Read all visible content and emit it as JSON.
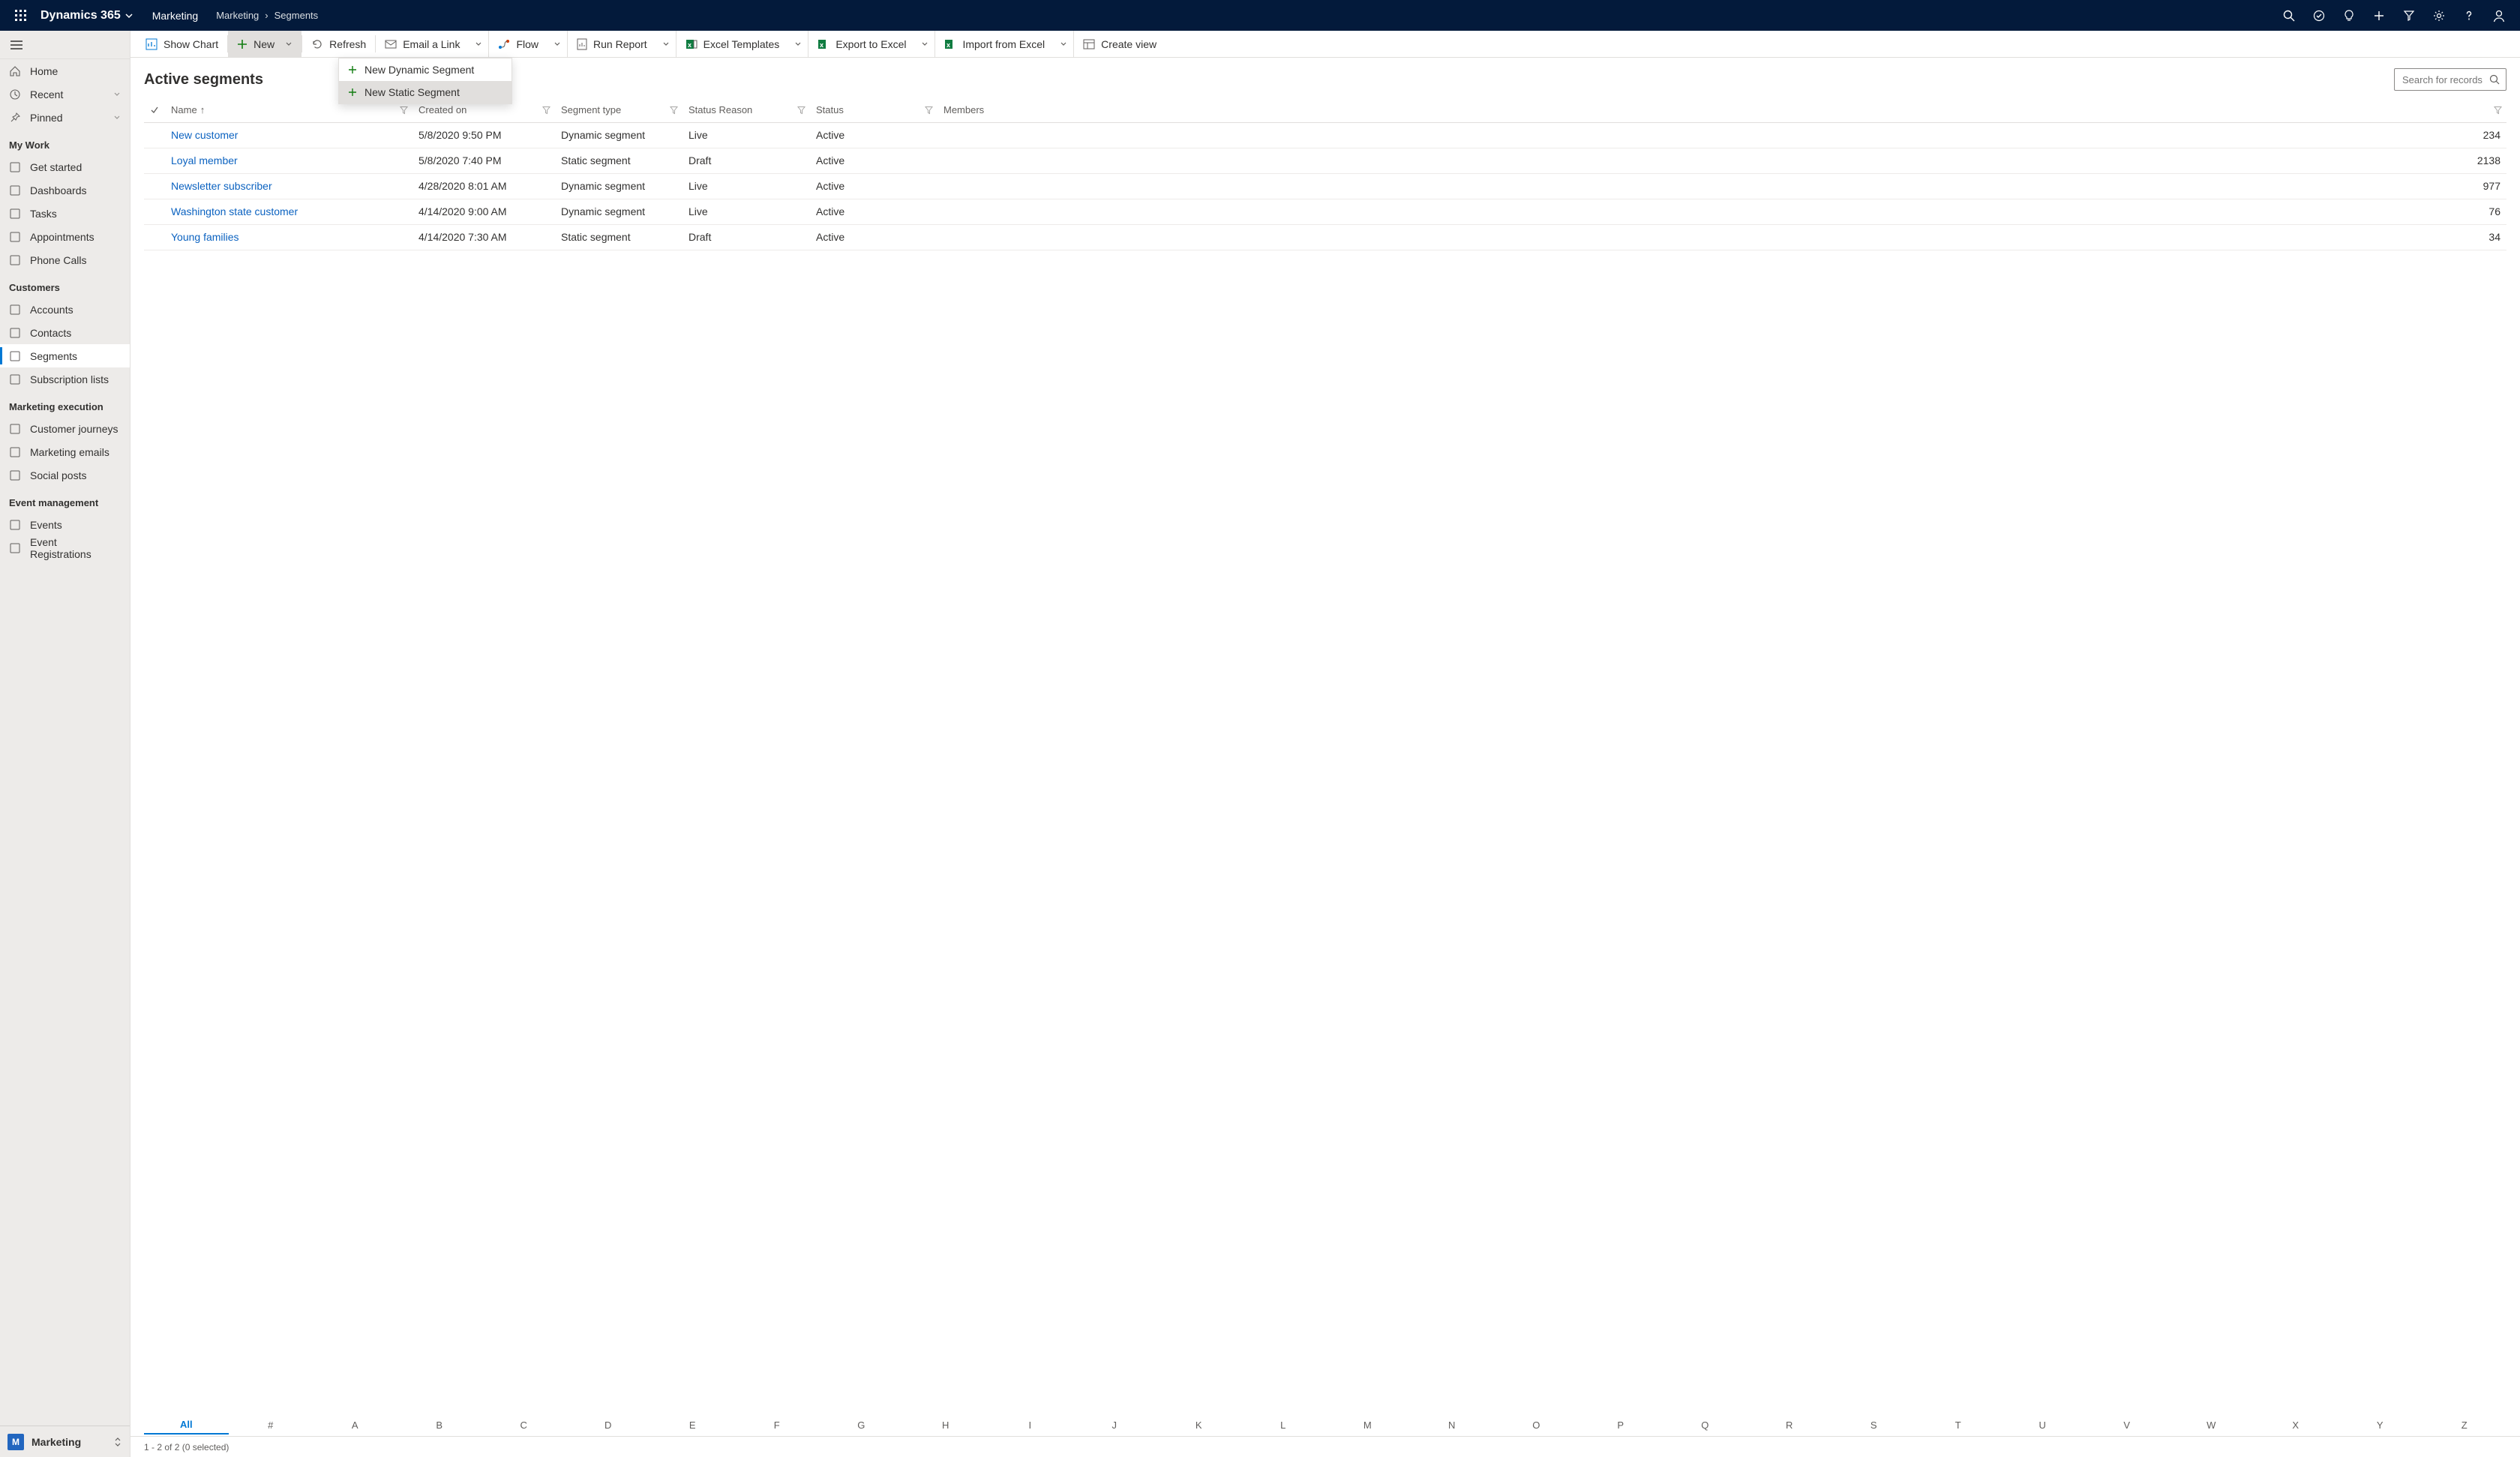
{
  "topnav": {
    "brand": "Dynamics 365",
    "area": "Marketing",
    "breadcrumb": [
      "Marketing",
      "Segments"
    ]
  },
  "sidebar": {
    "top": [
      {
        "label": "Home"
      },
      {
        "label": "Recent",
        "chevron": true
      },
      {
        "label": "Pinned",
        "chevron": true
      }
    ],
    "groups": [
      {
        "title": "My Work",
        "items": [
          {
            "label": "Get started"
          },
          {
            "label": "Dashboards"
          },
          {
            "label": "Tasks"
          },
          {
            "label": "Appointments"
          },
          {
            "label": "Phone Calls"
          }
        ]
      },
      {
        "title": "Customers",
        "items": [
          {
            "label": "Accounts"
          },
          {
            "label": "Contacts"
          },
          {
            "label": "Segments",
            "active": true
          },
          {
            "label": "Subscription lists"
          }
        ]
      },
      {
        "title": "Marketing execution",
        "items": [
          {
            "label": "Customer journeys"
          },
          {
            "label": "Marketing emails"
          },
          {
            "label": "Social posts"
          }
        ]
      },
      {
        "title": "Event management",
        "items": [
          {
            "label": "Events"
          },
          {
            "label": "Event Registrations"
          }
        ]
      }
    ],
    "area_switch": {
      "initial": "M",
      "label": "Marketing"
    }
  },
  "commands": {
    "show_chart": "Show Chart",
    "new": "New",
    "refresh": "Refresh",
    "email_link": "Email a Link",
    "flow": "Flow",
    "run_report": "Run Report",
    "excel_templates": "Excel Templates",
    "export_excel": "Export to Excel",
    "import_excel": "Import from Excel",
    "create_view": "Create view"
  },
  "new_menu": {
    "dynamic": "New Dynamic Segment",
    "static": "New Static Segment"
  },
  "view": {
    "title": "Active segments",
    "search_placeholder": "Search for records"
  },
  "columns": {
    "name": "Name",
    "created": "Created on",
    "type": "Segment type",
    "reason": "Status Reason",
    "status": "Status",
    "members": "Members"
  },
  "rows": [
    {
      "name": "New customer",
      "created": "5/8/2020 9:50 PM",
      "type": "Dynamic segment",
      "reason": "Live",
      "status": "Active",
      "members": "234"
    },
    {
      "name": "Loyal member",
      "created": "5/8/2020 7:40 PM",
      "type": "Static segment",
      "reason": "Draft",
      "status": "Active",
      "members": "2138"
    },
    {
      "name": "Newsletter subscriber",
      "created": "4/28/2020 8:01 AM",
      "type": "Dynamic segment",
      "reason": "Live",
      "status": "Active",
      "members": "977"
    },
    {
      "name": "Washington state customer",
      "created": "4/14/2020 9:00 AM",
      "type": "Dynamic segment",
      "reason": "Live",
      "status": "Active",
      "members": "76"
    },
    {
      "name": "Young families",
      "created": "4/14/2020 7:30 AM",
      "type": "Static segment",
      "reason": "Draft",
      "status": "Active",
      "members": "34"
    }
  ],
  "az": [
    "All",
    "#",
    "A",
    "B",
    "C",
    "D",
    "E",
    "F",
    "G",
    "H",
    "I",
    "J",
    "K",
    "L",
    "M",
    "N",
    "O",
    "P",
    "Q",
    "R",
    "S",
    "T",
    "U",
    "V",
    "W",
    "X",
    "Y",
    "Z"
  ],
  "footer": "1 - 2 of 2 (0 selected)"
}
